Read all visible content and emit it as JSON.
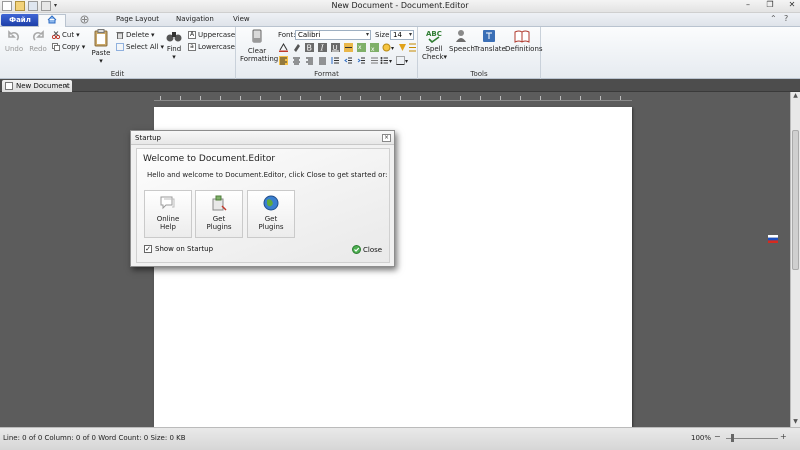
{
  "window": {
    "title": "New Document - Document.Editor",
    "controls": [
      "minimize-icon",
      "restore-icon",
      "close-icon"
    ]
  },
  "quick_access": [
    "new-document-icon",
    "open-folder-icon",
    "save-icon",
    "print-icon"
  ],
  "tabs": {
    "file": "Файл",
    "home_icon": "home-icon",
    "insert_icon": "insert-icon",
    "page_layout": "Page Layout",
    "navigation": "Navigation",
    "view": "View"
  },
  "ribbon": {
    "edit": {
      "label": "Edit",
      "undo": "Undo",
      "redo": "Redo",
      "cut": "Cut",
      "copy": "Copy",
      "paste": "Paste",
      "delete": "Delete",
      "select_all": "Select All",
      "find": "Find",
      "uppercase": "Uppercase",
      "lowercase": "Lowercase"
    },
    "format": {
      "label": "Format",
      "clear_formatting_1": "Clear",
      "clear_formatting_2": "Formatting",
      "font_label": "Font:",
      "font_value": "Calibri",
      "size_label": "Size:",
      "size_value": "14"
    },
    "tools": {
      "label": "Tools",
      "spell_check_1": "Spell",
      "spell_check_2": "Check",
      "speech": "Speech",
      "translate": "Translate",
      "definitions": "Definitions"
    }
  },
  "document_tab": {
    "label": "New Document",
    "close": "×"
  },
  "dialog": {
    "title": "Startup",
    "heading": "Welcome to Document.Editor",
    "message": "Hello and welcome to Document.Editor, click Close to get started or:",
    "tiles": [
      {
        "line1": "Online",
        "line2": "Help"
      },
      {
        "line1": "Get",
        "line2": "Plugins"
      },
      {
        "line1": "Get",
        "line2": "Plugins"
      }
    ],
    "show_on_startup": "Show on Startup",
    "show_on_startup_checked": true,
    "close_label": "Close"
  },
  "statusbar": {
    "stats": "Line: 0 of 0  Column: 0 of 0  Word Count: 0  Size: 0 KB",
    "zoom": "100%"
  },
  "colors": {
    "accent": "#2d6cc4",
    "file_tab": "#1d3fa8",
    "workspace": "#5c5c5c",
    "page": "#ffffff"
  }
}
